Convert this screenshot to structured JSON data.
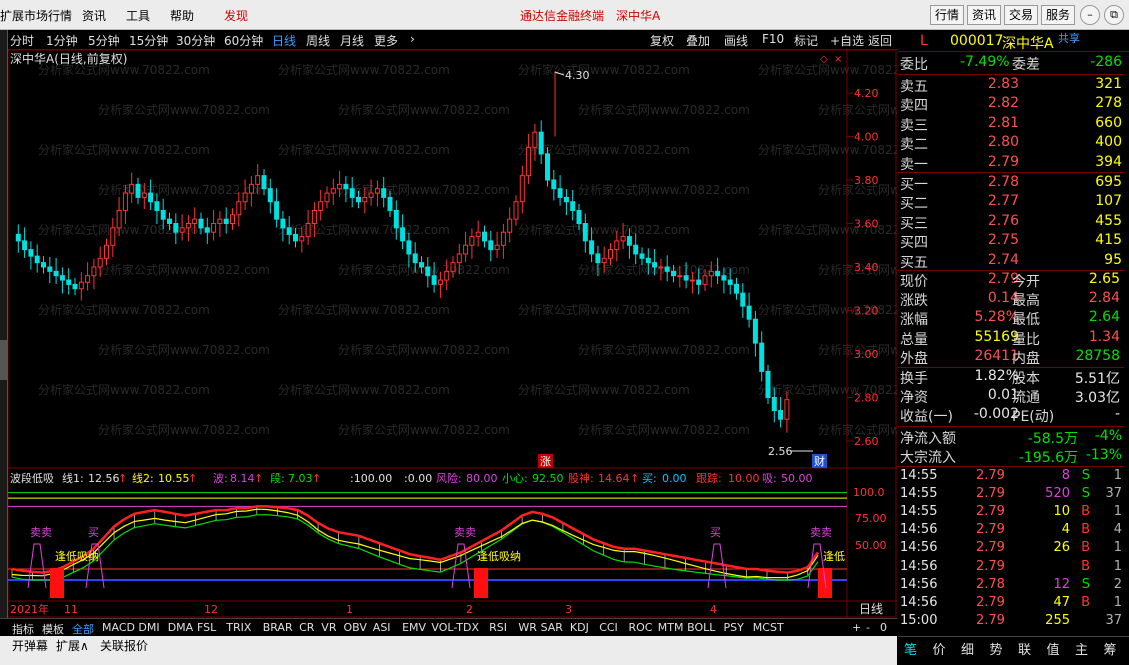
{
  "menu": {
    "items": [
      "扩展市场行情",
      "资讯",
      "工具",
      "帮助"
    ],
    "discover": "发现",
    "center_title": "通达信金融终端",
    "center_stock": "深中华A",
    "right_buttons": [
      "行情",
      "资讯",
      "交易",
      "服务"
    ]
  },
  "toolbar": {
    "periods": [
      "分时",
      "1分钟",
      "5分钟",
      "15分钟",
      "30分钟",
      "60分钟",
      "日线",
      "周线",
      "月线",
      "更多"
    ],
    "active": "日线",
    "actions": [
      "复权",
      "叠加",
      "画线",
      "F10",
      "标记",
      "+自选",
      "返回"
    ]
  },
  "chart": {
    "title": "深中华A(日线,前复权)",
    "price_labels": [
      "4.20",
      "4.00",
      "3.80",
      "3.60",
      "3.40",
      "3.20",
      "3.00",
      "2.80",
      "2.60"
    ],
    "high_mark": "4.30",
    "low_mark": "2.56",
    "marker_zhang": "涨",
    "marker_cai": "财",
    "watermark": "分析家公式网www.70822.com"
  },
  "indicator": {
    "name": "波段低吸",
    "line1_label": "线1:",
    "line1": "12.56",
    "line2_label": "线2:",
    "line2": "10.55",
    "bo_label": "波:",
    "bo": "8.14",
    "duan_label": "段:",
    "duan": "7.03",
    "v100": ":100.00",
    "v0": ":0.00",
    "fengxian_label": "风险:",
    "fengxian": "80.00",
    "xiaoxin_label": "小心:",
    "xiaoxin": "92.50",
    "gushen_label": "股神:",
    "gushen": "14.64",
    "mai_label": "买:",
    "mai": "0.00",
    "genzong_label": "跟踪:",
    "genzong": "10.00",
    "xi_label": "吸:",
    "xi": "50.00",
    "scale": [
      "100.0",
      "75.00",
      "50.00"
    ],
    "annot_buy": "买",
    "annot_sell": "卖卖",
    "annot_low": "逢低吸纳",
    "annot_low_short": "逢低"
  },
  "time_axis": {
    "labels": [
      "2021年",
      "11",
      "12",
      "1",
      "2",
      "3",
      "4"
    ],
    "period": "日线"
  },
  "tabs": {
    "items": [
      "指标",
      "模板",
      "全部",
      "MACD",
      "DMI",
      "DMA",
      "FSL",
      "TRIX",
      "BRAR",
      "CR",
      "VR",
      "OBV",
      "ASI",
      "EMV",
      "VOL-TDX",
      "RSI",
      "WR",
      "SAR",
      "KDJ",
      "CCI",
      "ROC",
      "MTM",
      "BOLL",
      "PSY",
      "MCST"
    ],
    "active": "全部",
    "controls": [
      "+",
      "-",
      "0"
    ]
  },
  "bottom_bar": {
    "items": [
      "开弹幕",
      "扩展∧",
      "关联报价"
    ]
  },
  "quote": {
    "flag": "L",
    "code": "000017",
    "name": "深中华A",
    "share": "共享",
    "weibi_label": "委比",
    "weibi": "-7.49%",
    "weicha_label": "委差",
    "weicha": "-286",
    "asks": [
      {
        "label": "卖五",
        "price": "2.83",
        "vol": "321"
      },
      {
        "label": "卖四",
        "price": "2.82",
        "vol": "278"
      },
      {
        "label": "卖三",
        "price": "2.81",
        "vol": "660"
      },
      {
        "label": "卖二",
        "price": "2.80",
        "vol": "400"
      },
      {
        "label": "卖一",
        "price": "2.79",
        "vol": "394"
      }
    ],
    "bids": [
      {
        "label": "买一",
        "price": "2.78",
        "vol": "695"
      },
      {
        "label": "买二",
        "price": "2.77",
        "vol": "107"
      },
      {
        "label": "买三",
        "price": "2.76",
        "vol": "455"
      },
      {
        "label": "买四",
        "price": "2.75",
        "vol": "415"
      },
      {
        "label": "买五",
        "price": "2.74",
        "vol": "95"
      }
    ],
    "stats": [
      {
        "l1": "现价",
        "v1": "2.79",
        "l2": "今开",
        "v2": "2.65"
      },
      {
        "l1": "涨跌",
        "v1": "0.14",
        "l2": "最高",
        "v2": "2.84"
      },
      {
        "l1": "涨幅",
        "v1": "5.28%",
        "l2": "最低",
        "v2": "2.64"
      },
      {
        "l1": "总量",
        "v1": "55169",
        "l2": "量比",
        "v2": "1.34"
      },
      {
        "l1": "外盘",
        "v1": "26411",
        "l2": "内盘",
        "v2": "28758"
      }
    ],
    "stats2": [
      {
        "l1": "换手",
        "v1": "1.82%",
        "l2": "股本",
        "v2": "5.51亿"
      },
      {
        "l1": "净资",
        "v1": "0.01",
        "l2": "流通",
        "v2": "3.03亿"
      },
      {
        "l1": "收益(一)",
        "v1": "-0.002",
        "l2": "PE(动)",
        "v2": "-"
      }
    ],
    "flows": [
      {
        "label": "净流入额",
        "v": "-58.5万",
        "p": "-4%"
      },
      {
        "label": "大宗流入",
        "v": "-195.6万",
        "p": "-13%"
      }
    ]
  },
  "ticks": [
    {
      "t": "14:55",
      "p": "2.79",
      "v": "8",
      "s": "S",
      "n": "1"
    },
    {
      "t": "14:55",
      "p": "2.79",
      "v": "520",
      "s": "S",
      "n": "37"
    },
    {
      "t": "14:55",
      "p": "2.79",
      "v": "10",
      "s": "B",
      "n": "1"
    },
    {
      "t": "14:56",
      "p": "2.79",
      "v": "4",
      "s": "B",
      "n": "4"
    },
    {
      "t": "14:56",
      "p": "2.79",
      "v": "26",
      "s": "B",
      "n": "1"
    },
    {
      "t": "14:56",
      "p": "2.79",
      "v": "",
      "s": "B",
      "n": "1"
    },
    {
      "t": "14:56",
      "p": "2.78",
      "v": "12",
      "s": "S",
      "n": "2"
    },
    {
      "t": "14:56",
      "p": "2.79",
      "v": "47",
      "s": "B",
      "n": "1"
    },
    {
      "t": "15:00",
      "p": "2.79",
      "v": "255",
      "s": "",
      "n": "37"
    }
  ],
  "right_tabs": {
    "items": [
      "笔",
      "价",
      "细",
      "势",
      "联",
      "值",
      "主",
      "筹"
    ],
    "active": "笔"
  },
  "colors": {
    "up": "#ff3232",
    "down": "#00e0e0",
    "accent": "#3aa0ff",
    "border": "#7a0000"
  }
}
